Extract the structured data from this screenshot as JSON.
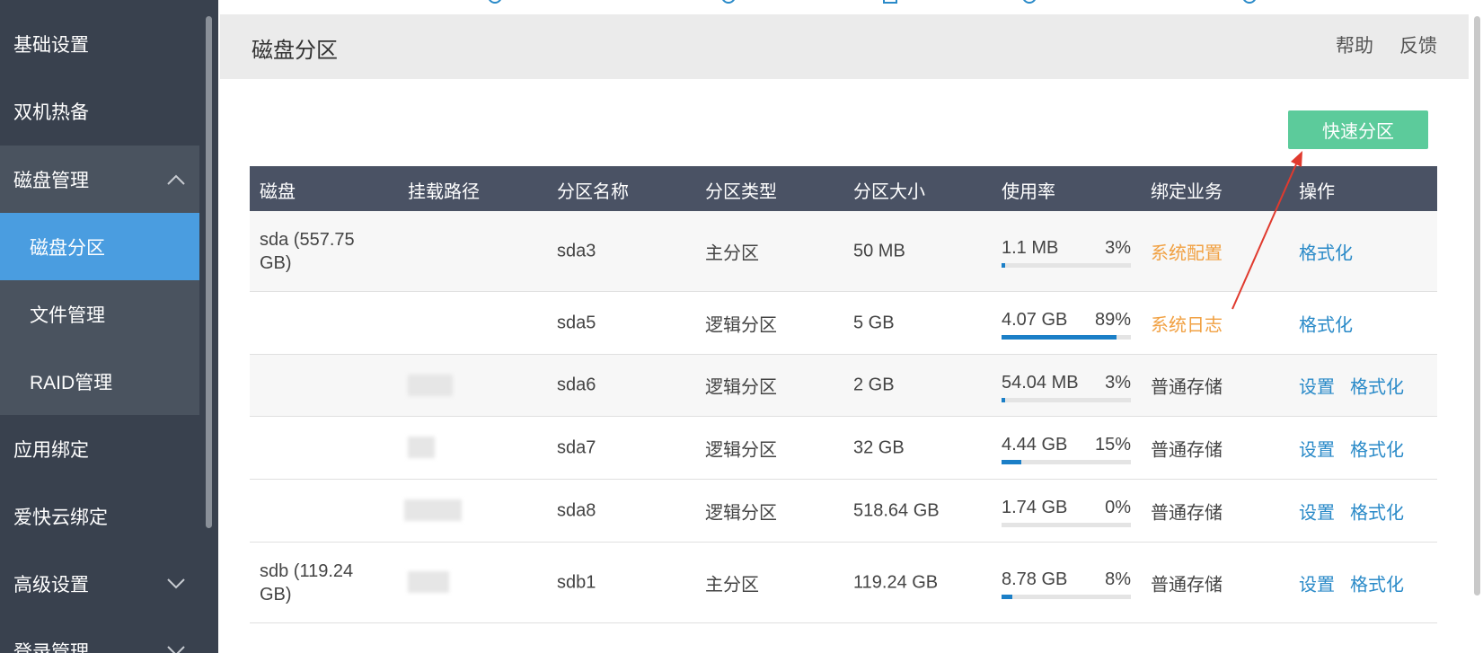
{
  "sidebar": {
    "items": [
      {
        "label": "基础设置"
      },
      {
        "label": "双机热备"
      },
      {
        "label": "磁盘管理"
      },
      {
        "label": "磁盘分区"
      },
      {
        "label": "文件管理"
      },
      {
        "label": "RAID管理"
      },
      {
        "label": "应用绑定"
      },
      {
        "label": "爱快云绑定"
      },
      {
        "label": "高级设置"
      },
      {
        "label": "登录管理"
      }
    ]
  },
  "header": {
    "title": "磁盘分区",
    "help": "帮助",
    "feedback": "反馈"
  },
  "actions": {
    "quick_partition": "快速分区"
  },
  "table": {
    "columns": [
      "磁盘",
      "挂载路径",
      "分区名称",
      "分区类型",
      "分区大小",
      "使用率",
      "绑定业务",
      "操作"
    ],
    "rows": [
      {
        "disk": "sda (557.75 GB)",
        "mount": "",
        "name": "sda3",
        "type": "主分区",
        "size": "50 MB",
        "used": "1.1 MB",
        "pct": "3%",
        "fill": 0.03,
        "service": "系统配置",
        "service_color": "#f1a143",
        "ops": [
          "格式化"
        ]
      },
      {
        "disk": "",
        "mount": "",
        "name": "sda5",
        "type": "逻辑分区",
        "size": "5 GB",
        "used": "4.07 GB",
        "pct": "89%",
        "fill": 0.89,
        "service": "系统日志",
        "service_color": "#f1a143",
        "ops": [
          "格式化"
        ]
      },
      {
        "disk": "",
        "mount": "",
        "name": "sda6",
        "type": "逻辑分区",
        "size": "2 GB",
        "used": "54.04 MB",
        "pct": "3%",
        "fill": 0.03,
        "service": "普通存储",
        "service_color": "#444444",
        "ops": [
          "设置",
          "格式化"
        ]
      },
      {
        "disk": "",
        "mount": "",
        "name": "sda7",
        "type": "逻辑分区",
        "size": "32 GB",
        "used": "4.44 GB",
        "pct": "15%",
        "fill": 0.15,
        "service": "普通存储",
        "service_color": "#444444",
        "ops": [
          "设置",
          "格式化"
        ]
      },
      {
        "disk": "",
        "mount": "",
        "name": "sda8",
        "type": "逻辑分区",
        "size": "518.64 GB",
        "used": "1.74 GB",
        "pct": "0%",
        "fill": 0.0,
        "service": "普通存储",
        "service_color": "#444444",
        "ops": [
          "设置",
          "格式化"
        ]
      },
      {
        "disk": "sdb (119.24 GB)",
        "mount": "",
        "name": "sdb1",
        "type": "主分区",
        "size": "119.24 GB",
        "used": "8.78 GB",
        "pct": "8%",
        "fill": 0.08,
        "service": "普通存储",
        "service_color": "#444444",
        "ops": [
          "设置",
          "格式化"
        ]
      }
    ]
  },
  "colors": {
    "sidebar_bg": "#39414e",
    "active": "#4a9de0",
    "header_row": "#4a5264",
    "button": "#5ccb9b",
    "link": "#2a8ac8",
    "warn": "#f1a143",
    "arrow": "#e03a2e"
  }
}
